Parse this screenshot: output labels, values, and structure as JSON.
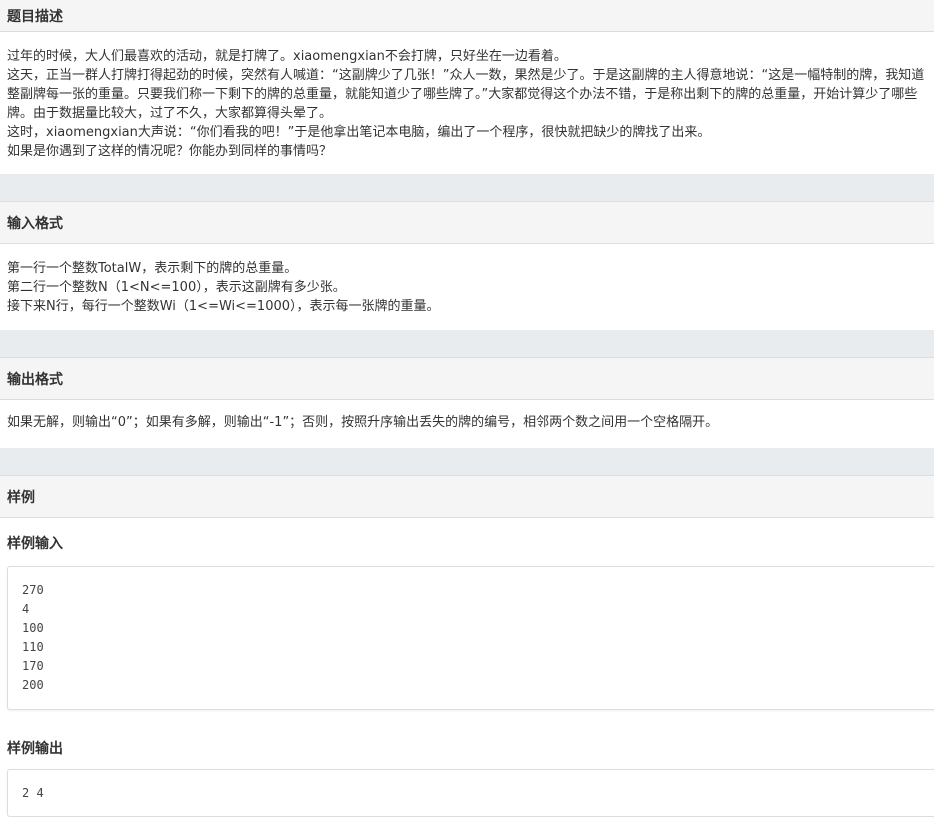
{
  "description": {
    "title": "题目描述",
    "paragraphs": [
      "过年的时候，大人们最喜欢的活动，就是打牌了。xiaomengxian不会打牌，只好坐在一边看着。",
      "这天，正当一群人打牌打得起劲的时候，突然有人喊道：“这副牌少了几张！”众人一数，果然是少了。于是这副牌的主人得意地说：“这是一幅特制的牌，我知道整副牌每一张的重量。只要我们称一下剩下的牌的总重量，就能知道少了哪些牌了。”大家都觉得这个办法不错，于是称出剩下的牌的总重量，开始计算少了哪些牌。由于数据量比较大，过了不久，大家都算得头晕了。",
      "这时，xiaomengxian大声说：“你们看我的吧！”于是他拿出笔记本电脑，编出了一个程序，很快就把缺少的牌找了出来。",
      "如果是你遇到了这样的情况呢？你能办到同样的事情吗？"
    ]
  },
  "input_format": {
    "title": "输入格式",
    "lines": [
      "第一行一个整数TotalW，表示剩下的牌的总重量。",
      "第二行一个整数N（1<N<=100），表示这副牌有多少张。",
      "接下来N行，每行一个整数Wi（1<=Wi<=1000），表示每一张牌的重量。"
    ]
  },
  "output_format": {
    "title": "输出格式",
    "lines": [
      "如果无解，则输出“0”；如果有多解，则输出“-1”；否则，按照升序输出丢失的牌的编号，相邻两个数之间用一个空格隔开。"
    ]
  },
  "samples": {
    "title": "样例",
    "input_title": "样例输入",
    "input_text": "270\n4\n100\n110\n170\n200",
    "output_title": "样例输出",
    "output_text": "2 4"
  }
}
